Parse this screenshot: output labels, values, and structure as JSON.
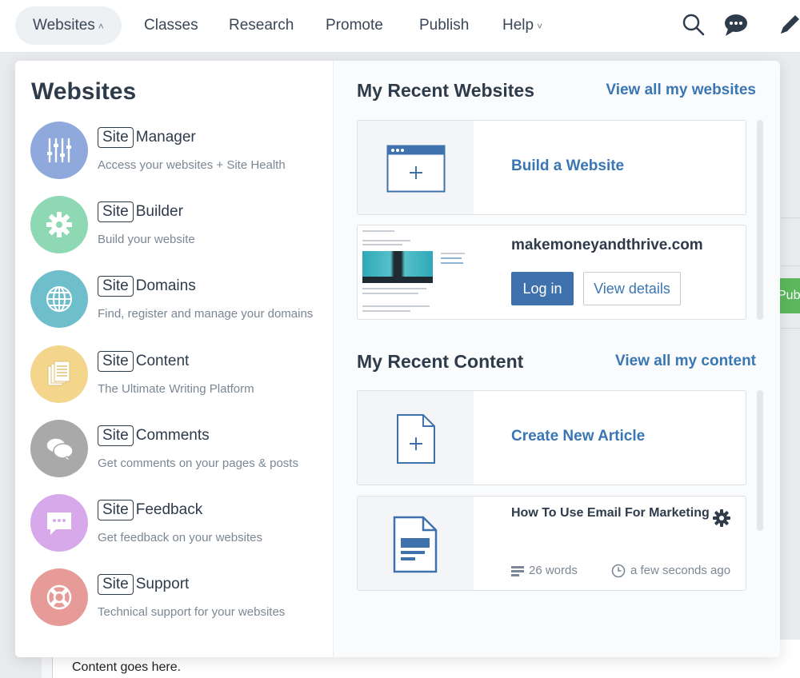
{
  "nav": {
    "items": [
      {
        "label": "Websites",
        "caret": "^"
      },
      {
        "label": "Classes"
      },
      {
        "label": "Research"
      },
      {
        "label": "Promote"
      },
      {
        "label": "Publish"
      },
      {
        "label": "Help",
        "caret": "v"
      }
    ],
    "icons": [
      "search-icon",
      "chat-icon",
      "pencil-icon"
    ]
  },
  "left": {
    "title": "Websites",
    "items": [
      {
        "prefix": "Site",
        "name": "Manager",
        "desc": "Access your websites + Site Health",
        "color": "#8fa9dc",
        "icon": "sliders-icon"
      },
      {
        "prefix": "Site",
        "name": "Builder",
        "desc": "Build your website",
        "color": "#8ed9b4",
        "icon": "gear-icon"
      },
      {
        "prefix": "Site",
        "name": "Domains",
        "desc": "Find, register and manage your domains",
        "color": "#6fbecc",
        "icon": "globe-icon"
      },
      {
        "prefix": "Site",
        "name": "Content",
        "desc": "The Ultimate Writing Platform",
        "color": "#f3d68c",
        "icon": "documents-icon"
      },
      {
        "prefix": "Site",
        "name": "Comments",
        "desc": "Get comments on your pages & posts",
        "color": "#a9a9a9",
        "icon": "speech-bubbles-icon"
      },
      {
        "prefix": "Site",
        "name": "Feedback",
        "desc": "Get feedback on your websites",
        "color": "#d7a9ea",
        "icon": "feedback-bubble-icon"
      },
      {
        "prefix": "Site",
        "name": "Support",
        "desc": "Technical support for your websites",
        "color": "#e79b98",
        "icon": "lifebuoy-icon"
      }
    ]
  },
  "right": {
    "websites": {
      "title": "My Recent Websites",
      "link": "View all my websites",
      "build_label": "Build a Website",
      "site": {
        "name": "makemoneyandthrive.com",
        "login": "Log in",
        "details": "View details"
      }
    },
    "content": {
      "title": "My Recent Content",
      "link": "View all my content",
      "create_label": "Create New Article",
      "article": {
        "title": "How To Use Email For Marketing",
        "words": "26 words",
        "time": "a few seconds ago"
      }
    }
  },
  "background": {
    "content_text": "Content goes here.",
    "pub_label": "Pub"
  },
  "colors": {
    "accent": "#3a76b4",
    "button": "#3f72ad",
    "publish_green": "#5cb85c"
  }
}
